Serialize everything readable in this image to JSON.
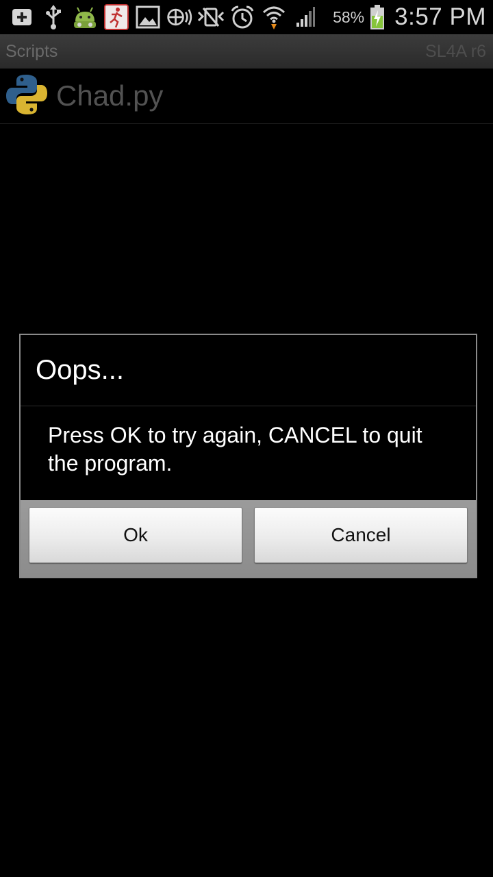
{
  "status_bar": {
    "icons": [
      "add-icon",
      "usb-icon",
      "android-debug-icon",
      "running-app-icon",
      "image-icon",
      "nfc-icon",
      "vibrate-icon",
      "alarm-icon",
      "wifi-icon",
      "signal-icon",
      "battery-charging-icon"
    ],
    "battery_percent": "58%",
    "time": "3:57 PM"
  },
  "title_bar": {
    "title": "Scripts",
    "version": "SL4A r6"
  },
  "scripts": [
    {
      "name": "Chad.py",
      "icon": "python-icon"
    }
  ],
  "dialog": {
    "title": "Oops...",
    "message": "Press OK to try again, CANCEL to quit the program.",
    "ok_label": "Ok",
    "cancel_label": "Cancel"
  },
  "colors": {
    "background": "#000000",
    "dialog_border": "#8a8a8a",
    "button_bar": "#939393",
    "python_blue": "#3a6f9e",
    "python_yellow": "#f2c735"
  }
}
